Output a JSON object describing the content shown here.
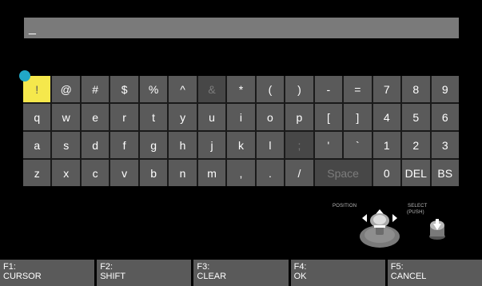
{
  "input": {
    "value": "_"
  },
  "keyboard": {
    "rows": [
      [
        {
          "l": "!",
          "s": "selected"
        },
        {
          "l": "@"
        },
        {
          "l": "#"
        },
        {
          "l": "$"
        },
        {
          "l": "%"
        },
        {
          "l": "^"
        },
        {
          "l": "&",
          "s": "dim"
        },
        {
          "l": "*"
        },
        {
          "l": "("
        },
        {
          "l": ")"
        },
        {
          "l": "-"
        },
        {
          "l": "="
        },
        {
          "l": "7"
        },
        {
          "l": "8"
        },
        {
          "l": "9"
        }
      ],
      [
        {
          "l": "q"
        },
        {
          "l": "w"
        },
        {
          "l": "e"
        },
        {
          "l": "r"
        },
        {
          "l": "t"
        },
        {
          "l": "y"
        },
        {
          "l": "u"
        },
        {
          "l": "i"
        },
        {
          "l": "o"
        },
        {
          "l": "p"
        },
        {
          "l": "["
        },
        {
          "l": "]"
        },
        {
          "l": "4"
        },
        {
          "l": "5"
        },
        {
          "l": "6"
        }
      ],
      [
        {
          "l": "a"
        },
        {
          "l": "s"
        },
        {
          "l": "d"
        },
        {
          "l": "f"
        },
        {
          "l": "g"
        },
        {
          "l": "h"
        },
        {
          "l": "j"
        },
        {
          "l": "k"
        },
        {
          "l": "l"
        },
        {
          "l": ";",
          "s": "dim"
        },
        {
          "l": "'"
        },
        {
          "l": "`"
        },
        {
          "l": "1"
        },
        {
          "l": "2"
        },
        {
          "l": "3"
        }
      ],
      [
        {
          "l": "z"
        },
        {
          "l": "x"
        },
        {
          "l": "c"
        },
        {
          "l": "v"
        },
        {
          "l": "b"
        },
        {
          "l": "n"
        },
        {
          "l": "m"
        },
        {
          "l": ","
        },
        {
          "l": "."
        },
        {
          "l": "/"
        },
        {
          "l": "Space",
          "s": "dim",
          "wide": true
        },
        {
          "l": "0"
        },
        {
          "l": "DEL"
        },
        {
          "l": "BS"
        }
      ]
    ]
  },
  "joystick": {
    "position_label": "POSITION",
    "select_label": "SELECT",
    "push_label": "(PUSH)"
  },
  "fkeys": [
    {
      "key": "F1:",
      "label": "CURSOR"
    },
    {
      "key": "F2:",
      "label": "SHIFT"
    },
    {
      "key": "F3:",
      "label": "CLEAR"
    },
    {
      "key": "F4:",
      "label": "OK"
    },
    {
      "key": "F5:",
      "label": "CANCEL"
    }
  ],
  "colors": {
    "selected": "#f5e84c",
    "indicator": "#21a8c7",
    "key": "#5a5a5a"
  }
}
